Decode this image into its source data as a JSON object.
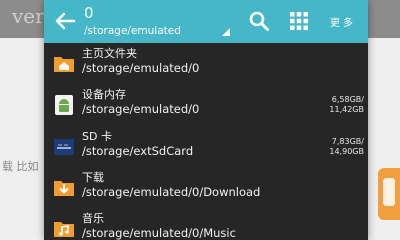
{
  "background": {
    "title": "ver",
    "snippet": "载 比如"
  },
  "appbar": {
    "count": "0",
    "path": "/storage/emulated",
    "more_label": "更多"
  },
  "items": [
    {
      "name": "主页文件夹",
      "path": "/storage/emulated/0",
      "size_used": "",
      "size_total": "",
      "icon": "home-folder-icon",
      "color": "#f29b2e"
    },
    {
      "name": "设备内存",
      "path": "/storage/emulated/0",
      "size_used": "6,58GB/",
      "size_total": "11,42GB",
      "icon": "android-icon",
      "color": "#6aa84f"
    },
    {
      "name": "SD 卡",
      "path": "/storage/extSdCard",
      "size_used": "7,83GB/",
      "size_total": "14,90GB",
      "icon": "sd-card-icon",
      "color": "#1c3d7a"
    },
    {
      "name": "下载",
      "path": "/storage/emulated/0/Download",
      "size_used": "",
      "size_total": "",
      "icon": "download-folder-icon",
      "color": "#f29b2e"
    },
    {
      "name": "音乐",
      "path": "/storage/emulated/0/Music",
      "size_used": "",
      "size_total": "",
      "icon": "music-folder-icon",
      "color": "#f29b2e"
    }
  ]
}
